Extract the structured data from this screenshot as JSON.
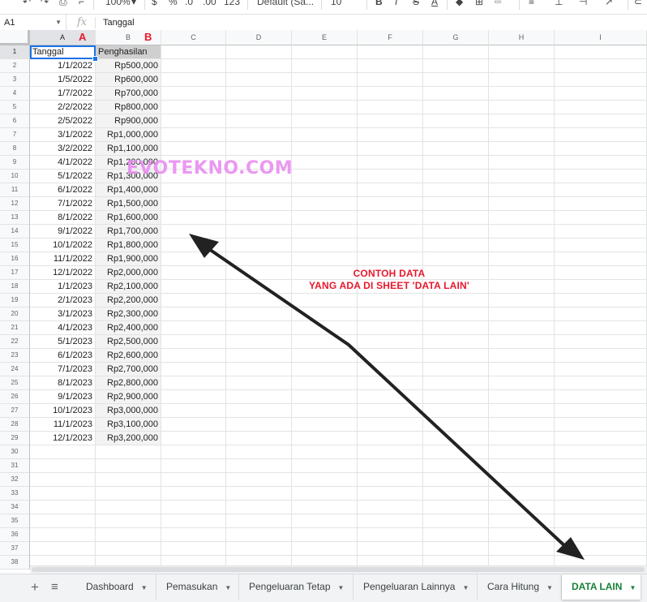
{
  "toolbar": {
    "zoom": "100%",
    "currency": "$",
    "percent": "%",
    "dec_decrease": ".0",
    "dec_increase": ".00",
    "format_more": "123",
    "font": "Default (Sa...",
    "font_size": "10",
    "bold": "B",
    "italic": "I",
    "strike": "S",
    "text_color": "A"
  },
  "formula_bar": {
    "name_box": "A1",
    "fx": "fx",
    "value": "Tanggal"
  },
  "columns": [
    "A",
    "B",
    "C",
    "D",
    "E",
    "F",
    "G",
    "H",
    "I"
  ],
  "column_markers": {
    "A": "A",
    "B": "B"
  },
  "rows": [
    {
      "n": "1",
      "a": "Tanggal",
      "b": "Penghasilan"
    },
    {
      "n": "2",
      "a": "1/1/2022",
      "b": "Rp500,000"
    },
    {
      "n": "3",
      "a": "1/5/2022",
      "b": "Rp600,000"
    },
    {
      "n": "4",
      "a": "1/7/2022",
      "b": "Rp700,000"
    },
    {
      "n": "5",
      "a": "2/2/2022",
      "b": "Rp800,000"
    },
    {
      "n": "6",
      "a": "2/5/2022",
      "b": "Rp900,000"
    },
    {
      "n": "7",
      "a": "3/1/2022",
      "b": "Rp1,000,000"
    },
    {
      "n": "8",
      "a": "3/2/2022",
      "b": "Rp1,100,000"
    },
    {
      "n": "9",
      "a": "4/1/2022",
      "b": "Rp1,200,000"
    },
    {
      "n": "10",
      "a": "5/1/2022",
      "b": "Rp1,300,000"
    },
    {
      "n": "11",
      "a": "6/1/2022",
      "b": "Rp1,400,000"
    },
    {
      "n": "12",
      "a": "7/1/2022",
      "b": "Rp1,500,000"
    },
    {
      "n": "13",
      "a": "8/1/2022",
      "b": "Rp1,600,000"
    },
    {
      "n": "14",
      "a": "9/1/2022",
      "b": "Rp1,700,000"
    },
    {
      "n": "15",
      "a": "10/1/2022",
      "b": "Rp1,800,000"
    },
    {
      "n": "16",
      "a": "11/1/2022",
      "b": "Rp1,900,000"
    },
    {
      "n": "17",
      "a": "12/1/2022",
      "b": "Rp2,000,000"
    },
    {
      "n": "18",
      "a": "1/1/2023",
      "b": "Rp2,100,000"
    },
    {
      "n": "19",
      "a": "2/1/2023",
      "b": "Rp2,200,000"
    },
    {
      "n": "20",
      "a": "3/1/2023",
      "b": "Rp2,300,000"
    },
    {
      "n": "21",
      "a": "4/1/2023",
      "b": "Rp2,400,000"
    },
    {
      "n": "22",
      "a": "5/1/2023",
      "b": "Rp2,500,000"
    },
    {
      "n": "23",
      "a": "6/1/2023",
      "b": "Rp2,600,000"
    },
    {
      "n": "24",
      "a": "7/1/2023",
      "b": "Rp2,700,000"
    },
    {
      "n": "25",
      "a": "8/1/2023",
      "b": "Rp2,800,000"
    },
    {
      "n": "26",
      "a": "9/1/2023",
      "b": "Rp2,900,000"
    },
    {
      "n": "27",
      "a": "10/1/2023",
      "b": "Rp3,000,000"
    },
    {
      "n": "28",
      "a": "11/1/2023",
      "b": "Rp3,100,000"
    },
    {
      "n": "29",
      "a": "12/1/2023",
      "b": "Rp3,200,000"
    },
    {
      "n": "30",
      "a": "",
      "b": ""
    },
    {
      "n": "31",
      "a": "",
      "b": ""
    },
    {
      "n": "32",
      "a": "",
      "b": ""
    },
    {
      "n": "33",
      "a": "",
      "b": ""
    },
    {
      "n": "34",
      "a": "",
      "b": ""
    },
    {
      "n": "35",
      "a": "",
      "b": ""
    },
    {
      "n": "36",
      "a": "",
      "b": ""
    },
    {
      "n": "37",
      "a": "",
      "b": ""
    },
    {
      "n": "38",
      "a": "",
      "b": ""
    }
  ],
  "watermark": "EVOTEKNO.COM",
  "annotation": {
    "line1": "CONTOH DATA",
    "line2": "YANG ADA DI SHEET 'DATA LAIN'",
    "color": "#e8182c"
  },
  "tabs": [
    {
      "label": "Dashboard",
      "active": false
    },
    {
      "label": "Pemasukan",
      "active": false
    },
    {
      "label": "Pengeluaran Tetap",
      "active": false
    },
    {
      "label": "Pengeluaran Lainnya",
      "active": false
    },
    {
      "label": "Cara Hitung",
      "active": false
    },
    {
      "label": "DATA LAIN",
      "active": true
    }
  ],
  "tab_icons": {
    "add": "+",
    "all_sheets": "≡"
  }
}
